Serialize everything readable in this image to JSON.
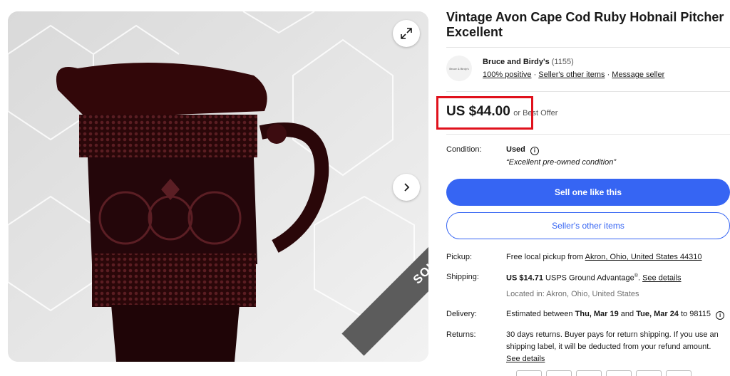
{
  "gallery": {
    "expand_icon": "expand-icon",
    "next_icon": "chevron-right-icon",
    "sold_label": "SOLD"
  },
  "listing": {
    "title": "Vintage Avon Cape Cod Ruby Hobnail Pitcher Excellent",
    "price": "US $44.00",
    "best_offer": "or Best Offer"
  },
  "seller": {
    "logo_text": "Bruce & Birdy's",
    "name": "Bruce and Birdy's",
    "feedback_count": "(1155)",
    "positive": "100% positive",
    "other_items_link": "Seller's other items",
    "message_link": "Message seller",
    "separator": "·"
  },
  "condition": {
    "label": "Condition:",
    "value": "Used",
    "note": "“Excellent pre-owned condition”"
  },
  "buttons": {
    "sell_one": "Sell one like this",
    "other_items": "Seller's other items"
  },
  "pickup": {
    "label": "Pickup:",
    "text": "Free local pickup from ",
    "location": "Akron, Ohio, United States 44310"
  },
  "shipping": {
    "label": "Shipping:",
    "cost": "US $14.71",
    "service": " USPS Ground Advantage",
    "reg": "®",
    "details_link": "See details",
    "located": "Located in: Akron, Ohio, United States"
  },
  "delivery": {
    "label": "Delivery:",
    "prefix": "Estimated between ",
    "start": "Thu, Mar 19",
    "mid": " and ",
    "end": "Tue, Mar 24",
    "suffix": " to 98115"
  },
  "returns": {
    "label": "Returns:",
    "line1": "30 days returns. Buyer pays for return shipping. If you use an",
    "line2": "shipping label, it will be deducted from your refund amount.",
    "details_link": "See details"
  },
  "colors": {
    "accent": "#3665f3",
    "highlight": "#e0111c",
    "sold_ribbon": "#5c5c5c"
  }
}
